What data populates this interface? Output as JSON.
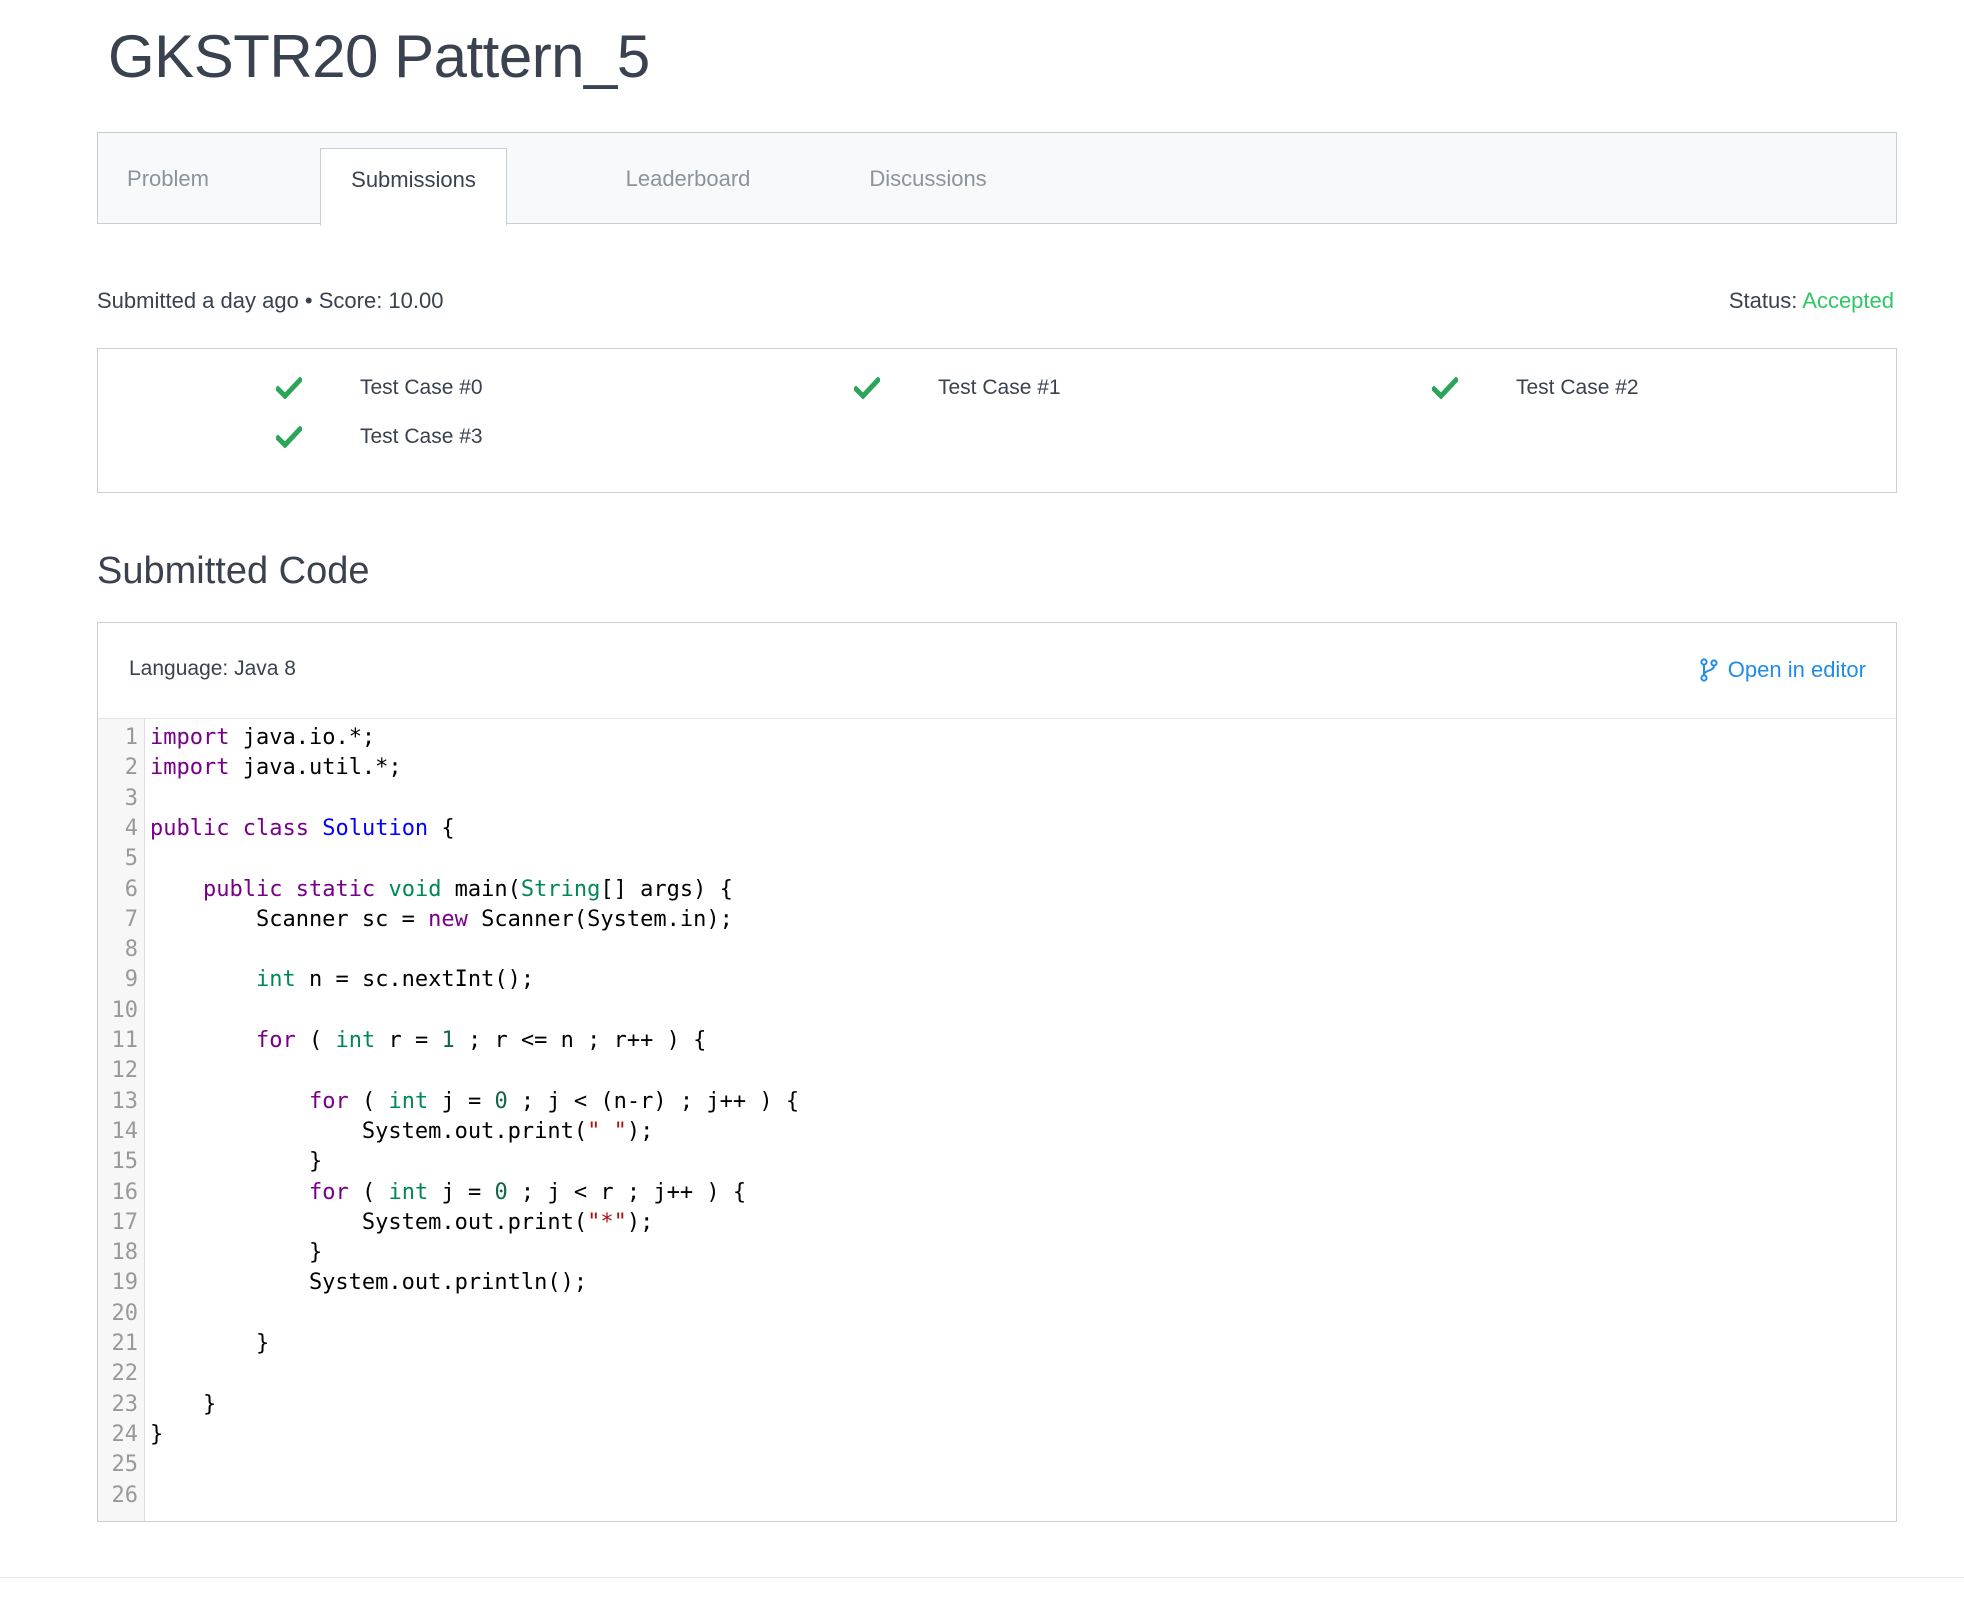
{
  "page": {
    "title": "GKSTR20 Pattern_5"
  },
  "tabs": [
    {
      "label": "Problem",
      "active": false
    },
    {
      "label": "Submissions",
      "active": true
    },
    {
      "label": "Leaderboard",
      "active": false
    },
    {
      "label": "Discussions",
      "active": false
    }
  ],
  "submission": {
    "meta": "Submitted a day ago • Score: 10.00",
    "status_label": "Status:",
    "status_value": "Accepted"
  },
  "test_cases": [
    {
      "label": "Test Case #0",
      "passed": true
    },
    {
      "label": "Test Case #1",
      "passed": true
    },
    {
      "label": "Test Case #2",
      "passed": true
    },
    {
      "label": "Test Case #3",
      "passed": true
    }
  ],
  "code_section": {
    "title": "Submitted Code",
    "language": "Language: Java 8",
    "open_in_editor": "Open in editor",
    "lines": [
      "import java.io.*;",
      "import java.util.*;",
      "",
      "public class Solution {",
      "",
      "    public static void main(String[] args) {",
      "        Scanner sc = new Scanner(System.in);",
      "",
      "        int n = sc.nextInt();",
      "",
      "        for ( int r = 1 ; r <= n ; r++ ) {",
      "",
      "            for ( int j = 0 ; j < (n-r) ; j++ ) {",
      "                System.out.print(\" \");",
      "            }",
      "            for ( int j = 0 ; j < r ; j++ ) {",
      "                System.out.print(\"*\");",
      "            }",
      "            System.out.println();",
      "",
      "        }",
      "",
      "    }",
      "}",
      "",
      ""
    ]
  },
  "colors": {
    "accent": "#1f8ce6",
    "accepted": "#2ec866",
    "check": "#2ca55a"
  }
}
